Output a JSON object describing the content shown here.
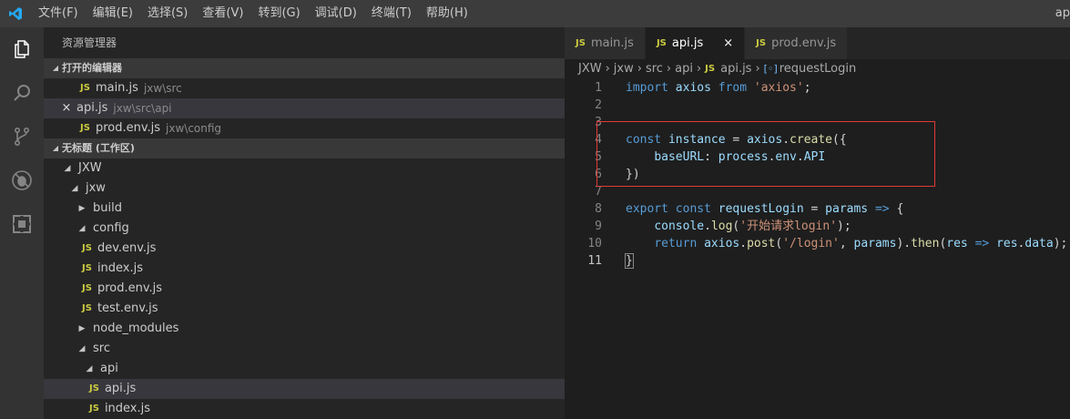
{
  "titlebar": {
    "menu": [
      "文件(F)",
      "编辑(E)",
      "选择(S)",
      "查看(V)",
      "转到(G)",
      "调试(D)",
      "终端(T)",
      "帮助(H)"
    ],
    "right_text": "ap"
  },
  "activity": {
    "icons": [
      "explorer-icon",
      "search-icon",
      "source-control-icon",
      "debug-icon",
      "extensions-icon"
    ]
  },
  "sidebar": {
    "title": "资源管理器",
    "open_editors_header": "打开的编辑器",
    "open_editors": [
      {
        "name": "main.js",
        "path": "jxw\\src"
      },
      {
        "name": "api.js",
        "path": "jxw\\src\\api",
        "close": "×"
      },
      {
        "name": "prod.env.js",
        "path": "jxw\\config"
      }
    ],
    "workspace_header": "无标题 (工作区)",
    "tree": {
      "jxw_root": "JXW",
      "jxw": "jxw",
      "build": "build",
      "config": "config",
      "dev_env": "dev.env.js",
      "index_config": "index.js",
      "prod_env": "prod.env.js",
      "test_env": "test.env.js",
      "node_modules": "node_modules",
      "src": "src",
      "api_folder": "api",
      "api_js": "api.js",
      "index_api": "index.js"
    },
    "js_badge": "JS"
  },
  "editor": {
    "tabs": [
      {
        "label": "main.js"
      },
      {
        "label": "api.js",
        "close": "×"
      },
      {
        "label": "prod.env.js"
      }
    ],
    "breadcrumb": {
      "parts": [
        "JXW",
        "jxw",
        "src",
        "api"
      ],
      "file": "api.js",
      "symbol": "requestLogin"
    },
    "line_numbers": [
      "1",
      "2",
      "3",
      "4",
      "5",
      "6",
      "7",
      "8",
      "9",
      "10",
      "11"
    ],
    "code": {
      "l1_import": "import",
      "l1_axios": "axios",
      "l1_from": "from",
      "l1_str": "'axios'",
      "l1_end": ";",
      "l4_const": "const",
      "l4_instance": "instance",
      "l4_eq": " = ",
      "l4_axios": "axios",
      "l4_dot": ".",
      "l4_create": "create",
      "l4_open": "({",
      "l5_indent": "    ",
      "l5_key": "baseURL",
      "l5_colon": ": ",
      "l5_process": "process",
      "l5_dot1": ".",
      "l5_env": "env",
      "l5_dot2": ".",
      "l5_api": "API",
      "l6_close": "})",
      "l8_export": "export",
      "l8_const": "const",
      "l8_name": "requestLogin",
      "l8_eq": " = ",
      "l8_params": "params",
      "l8_arrow": " => ",
      "l8_brace": "{",
      "l9_indent": "    ",
      "l9_console": "console",
      "l9_dot": ".",
      "l9_log": "log",
      "l9_open": "(",
      "l9_str": "'开始请求login'",
      "l9_close": ");",
      "l10_indent": "    ",
      "l10_return": "return",
      "l10_axios": "axios",
      "l10_dot": ".",
      "l10_post": "post",
      "l10_open": "(",
      "l10_str": "'/login'",
      "l10_comma": ", ",
      "l10_params": "params",
      "l10_close": ").",
      "l10_then": "then",
      "l10_open2": "(",
      "l10_res": "res",
      "l10_arrow": " => ",
      "l10_res2": "res",
      "l10_dot2": ".",
      "l10_data": "data",
      "l10_end": ");",
      "l11_close": "}"
    }
  },
  "colors": {
    "keyword": "#569cd6",
    "string": "#ce9178",
    "variable": "#9cdcfe",
    "function": "#dcdcaa",
    "js_badge": "#cbcb41",
    "highlight_box": "#e03a3a"
  }
}
